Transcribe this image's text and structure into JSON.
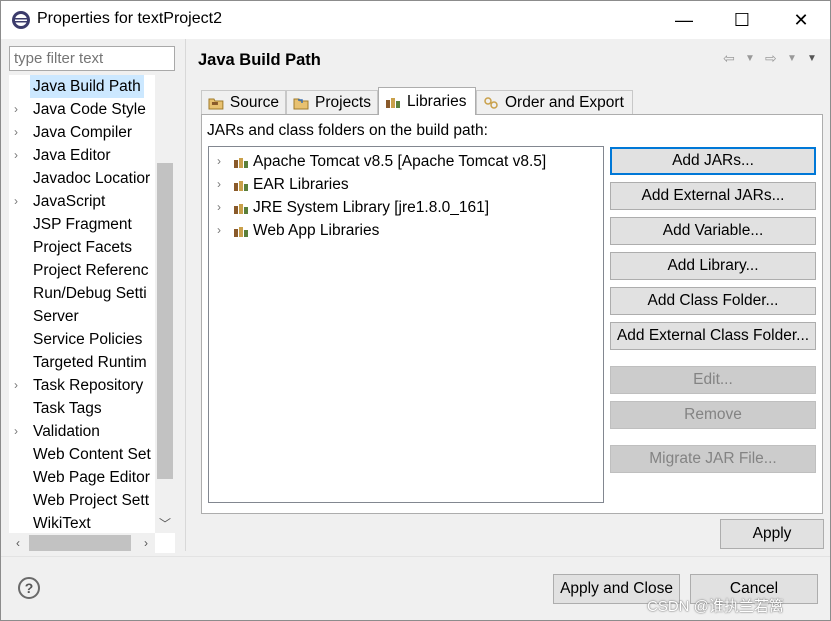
{
  "window": {
    "title": "Properties for textProject2",
    "minimize": "—",
    "maximize": "☐",
    "close": "✕"
  },
  "sidebar": {
    "filter_placeholder": "type filter text",
    "items": [
      {
        "label": "Java Build Path",
        "expandable": false,
        "selected": true
      },
      {
        "label": "Java Code Style",
        "expandable": true
      },
      {
        "label": "Java Compiler",
        "expandable": true
      },
      {
        "label": "Java Editor",
        "expandable": true
      },
      {
        "label": "Javadoc Locatior",
        "expandable": false
      },
      {
        "label": "JavaScript",
        "expandable": true
      },
      {
        "label": "JSP Fragment",
        "expandable": false
      },
      {
        "label": "Project Facets",
        "expandable": false
      },
      {
        "label": "Project Referenc",
        "expandable": false
      },
      {
        "label": "Run/Debug Setti",
        "expandable": false
      },
      {
        "label": "Server",
        "expandable": false
      },
      {
        "label": "Service Policies",
        "expandable": false
      },
      {
        "label": "Targeted Runtim",
        "expandable": false
      },
      {
        "label": "Task Repository",
        "expandable": true
      },
      {
        "label": "Task Tags",
        "expandable": false
      },
      {
        "label": "Validation",
        "expandable": true
      },
      {
        "label": "Web Content Set",
        "expandable": false
      },
      {
        "label": "Web Page Editor",
        "expandable": false
      },
      {
        "label": "Web Project Sett",
        "expandable": false
      },
      {
        "label": "WikiText",
        "expandable": false
      }
    ]
  },
  "main": {
    "title": "Java Build Path",
    "tabs": [
      {
        "label": "Source",
        "icon": "source-folder-icon"
      },
      {
        "label": "Projects",
        "icon": "projects-icon"
      },
      {
        "label": "Libraries",
        "icon": "libraries-icon",
        "active": true
      },
      {
        "label": "Order and Export",
        "icon": "order-export-icon"
      }
    ],
    "caption": "JARs and class folders on the build path:",
    "libraries": [
      "Apache Tomcat v8.5 [Apache Tomcat v8.5]",
      "EAR Libraries",
      "JRE System Library [jre1.8.0_161]",
      "Web App Libraries"
    ],
    "buttons": {
      "add_jars": "Add JARs...",
      "add_external_jars": "Add External JARs...",
      "add_variable": "Add Variable...",
      "add_library": "Add Library...",
      "add_class_folder": "Add Class Folder...",
      "add_external_class_folder": "Add External Class Folder...",
      "edit": "Edit...",
      "remove": "Remove",
      "migrate_jar": "Migrate JAR File..."
    },
    "apply": "Apply"
  },
  "footer": {
    "help": "?",
    "apply_and_close": "Apply and Close",
    "cancel": "Cancel"
  },
  "watermark": "CSDN @谁执兰若篱",
  "colors": {
    "selection": "#cce8ff",
    "default_button_border": "#0078d7",
    "disabled_text": "#838383"
  }
}
